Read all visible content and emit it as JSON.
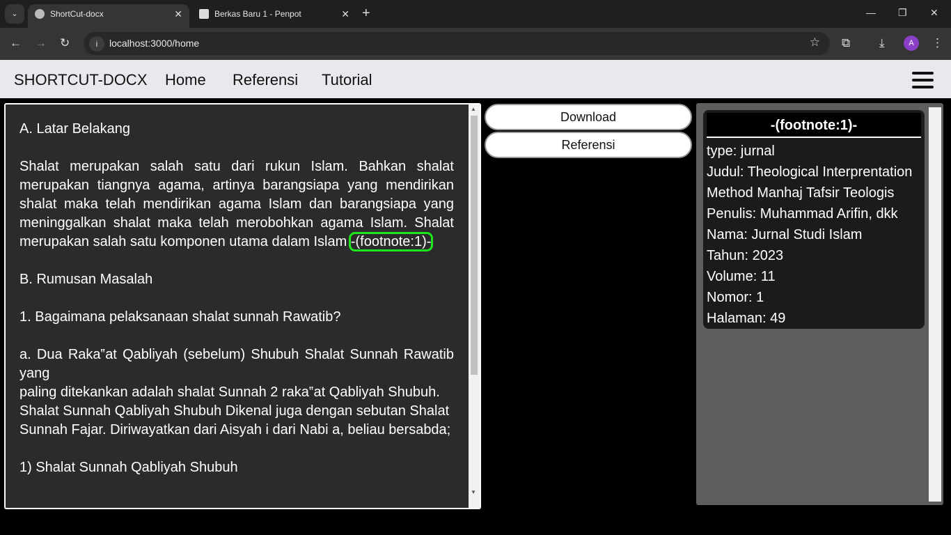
{
  "browser": {
    "tabs": [
      {
        "title": "ShortCut-docx",
        "active": true
      },
      {
        "title": "Berkas Baru 1 - Penpot",
        "active": false
      }
    ],
    "url": "localhost:3000/home",
    "profile_initial": "A"
  },
  "nav": {
    "brand": "SHORTCUT-DOCX",
    "links": [
      "Home",
      "Referensi",
      "Tutorial"
    ]
  },
  "editor": {
    "heading_a": "A. Latar Belakang",
    "para1": "Shalat merupakan salah satu dari rukun Islam. Bahkan shalat merupakan tiangnya agama, artinya barangsiapa yang mendirikan shalat maka telah mendirikan agama Islam dan barangsiapa yang meninggalkan shalat maka telah merobohkan agama Islam. Shalat merupakan salah satu komponen utama dalam Islam",
    "footnote_marker": "-(footnote:1)-",
    "heading_b": "B. Rumusan Masalah",
    "question1": "1. Bagaimana pelaksanaan shalat sunnah Rawatib?",
    "para_a": [
      "a. Dua Raka‟at Qabliyah (sebelum) Shubuh Shalat Sunnah Rawatib yang",
      "paling ditekankan adalah shalat Sunnah 2 raka‟at Qabliyah Shubuh.",
      "Shalat Sunnah Qabliyah Shubuh Dikenal juga dengan sebutan Shalat",
      "Sunnah Fajar. Diriwayatkan dari Aisyah i dari Nabi a, beliau bersabda;"
    ],
    "item1": "1) Shalat Sunnah Qabliyah Shubuh",
    "highlight_color": "#1ee61e"
  },
  "actions": {
    "download": "Download",
    "referensi": "Referensi"
  },
  "footnote": {
    "title": "-(footnote:1)-",
    "fields": [
      "type: jurnal",
      "Judul: Theological Interprentation",
      "Method Manhaj Tafsir Teologis",
      "Penulis: Muhammad Arifin, dkk",
      "Nama: Jurnal Studi Islam",
      "Tahun: 2023",
      "Volume: 11",
      "Nomor: 1",
      "Halaman: 49"
    ]
  }
}
